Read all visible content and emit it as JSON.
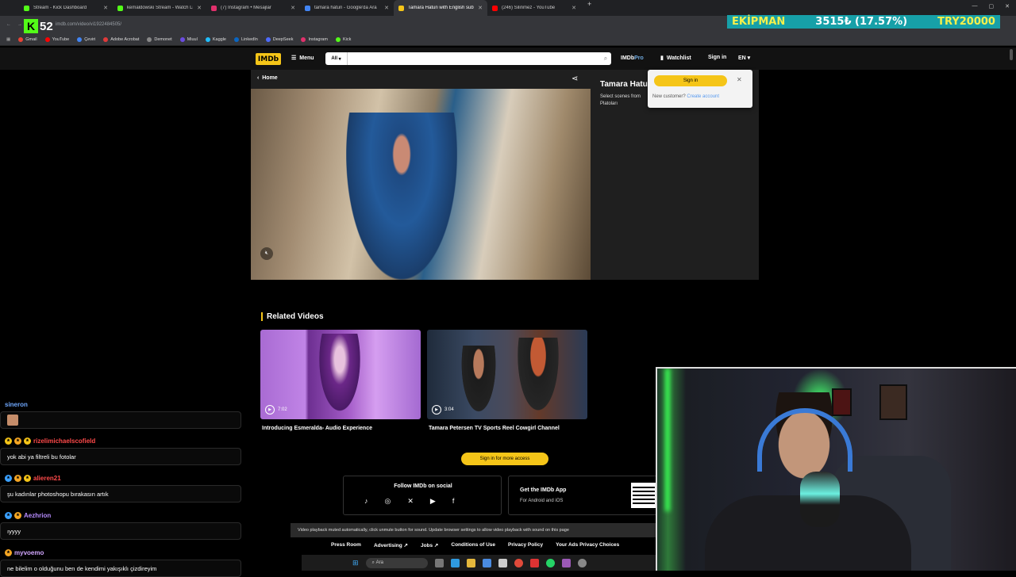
{
  "browser": {
    "tabs": [
      {
        "label": "Stream - Kick Dashboard",
        "color": "#53fc18",
        "active": false
      },
      {
        "label": "kemaldowski Stream - Watch Li...",
        "color": "#53fc18",
        "active": false
      },
      {
        "label": "(7) Instagram • Mesajlar",
        "color": "#e1306c",
        "active": false
      },
      {
        "label": "tamara hatun - Google'da Ara",
        "color": "#4285f4",
        "active": false
      },
      {
        "label": "Tamara Hatun with English subt...",
        "color": "#f5c518",
        "active": true
      },
      {
        "label": "(246) Silinmez - YouTube",
        "color": "#ff0000",
        "active": false
      }
    ],
    "url": "imdb.com/video/vi1922484505/",
    "bookmarks": [
      {
        "label": "Gmail",
        "color": "#ea4335"
      },
      {
        "label": "YouTube",
        "color": "#ff0000"
      },
      {
        "label": "Çeviri",
        "color": "#4285f4"
      },
      {
        "label": "Adobe Acrobat",
        "color": "#e03a3a"
      },
      {
        "label": "Demonet",
        "color": "#888888"
      },
      {
        "label": "Miuul",
        "color": "#6b4ce0"
      },
      {
        "label": "Kaggle",
        "color": "#20beff"
      },
      {
        "label": "LinkedIn",
        "color": "#0a66c2"
      },
      {
        "label": "DeepSeek",
        "color": "#4d6bfe"
      },
      {
        "label": "Instagram",
        "color": "#e1306c"
      },
      {
        "label": "Kick",
        "color": "#53fc18"
      }
    ]
  },
  "overlay": {
    "kick_number": "52",
    "ticker_name": "EKİPMAN",
    "ticker_value": "3515₺ (17.57%)",
    "ticker_goal": "TRY20000"
  },
  "imdb": {
    "logo": "IMDb",
    "menu": "Menu",
    "search_category": "All",
    "search_placeholder": "",
    "pro_prefix": "IMDb",
    "pro_suffix": "Pro",
    "watchlist": "Watchlist",
    "signin": "Sign in",
    "lang": "EN",
    "home": "Home",
    "video_title": "Tamara Hatun",
    "video_desc": "Select scenes from Platoları",
    "popup": {
      "signin": "Sign in",
      "new_customer": "New customer?",
      "create_account": "Create account"
    },
    "related_title": "Related Videos",
    "related": [
      {
        "duration": "7:02",
        "title": "Introducing Esmeralda- Audio Experience"
      },
      {
        "duration": "3:04",
        "title": "Tamara Petersen TV Sports Reel Cowgirl Channel"
      }
    ],
    "signin_more": "Sign in for more access",
    "follow_title": "Follow IMDb on social",
    "social_icons": [
      "tiktok-icon",
      "instagram-icon",
      "x-icon",
      "youtube-icon",
      "facebook-icon"
    ],
    "app_title": "Get the IMDb App",
    "app_sub": "For Android and iOS",
    "mute_notice": "Video playback muted automatically, click unmute button for sound. Update browser settings to allow video playback with sound on this page",
    "footer": [
      "Press Room",
      "Advertising ↗",
      "Jobs ↗",
      "Conditions of Use",
      "Privacy Policy",
      "Your Ads Privacy Choices"
    ]
  },
  "chat": [
    {
      "user": "sineron",
      "color": "#6fa8ff",
      "text": "",
      "badges": []
    },
    {
      "user": "rizelimichaelscofield",
      "color": "#ff4a4a",
      "text": "yok abi ya filtreli bu fotolar",
      "badges": [
        "#f5c518",
        "#f5a623",
        "#f5c518"
      ]
    },
    {
      "user": "alieren21",
      "color": "#ff4a4a",
      "text": "şu kadınlar photoshopu bırakasın artık",
      "badges": [
        "#3aa0ff",
        "#f5a623",
        "#f5c518"
      ]
    },
    {
      "user": "Aezhrion",
      "color": "#b78cff",
      "text": "ıyyyy",
      "badges": [
        "#3aa0ff",
        "#f5a623"
      ]
    },
    {
      "user": "myvoemo",
      "color": "#d2a7ff",
      "text": "ne bilelim o olduğunu ben de kendimi yakışıklı çizdireyim",
      "badges": [
        "#f5a623"
      ]
    }
  ],
  "taskbar": {
    "search": "Ara"
  }
}
